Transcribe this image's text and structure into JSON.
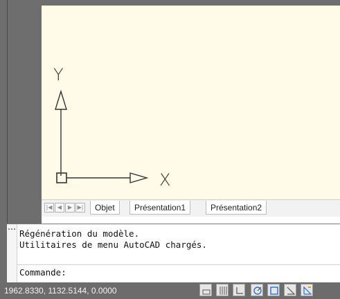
{
  "canvas": {
    "background": "#fffbe8",
    "ucs": {
      "x_label": "X",
      "y_label": "Y"
    }
  },
  "tabs": [
    {
      "label": "Objet",
      "active": true
    },
    {
      "label": "Présentation1",
      "active": false
    },
    {
      "label": "Présentation2",
      "active": false
    }
  ],
  "nav_buttons": [
    {
      "icon": "first-icon",
      "glyph": "|◀"
    },
    {
      "icon": "prev-icon",
      "glyph": "◀"
    },
    {
      "icon": "next-icon",
      "glyph": "▶"
    },
    {
      "icon": "last-icon",
      "glyph": "▶|"
    }
  ],
  "command_line": {
    "history": [
      "Régénération du modèle.",
      "Utilitaires de menu AutoCAD chargés."
    ],
    "prompt": "Commande:"
  },
  "status_bar": {
    "coordinates": "1962.8330, 1132.5144, 0.0000",
    "toggles": [
      {
        "icon": "snap-icon"
      },
      {
        "icon": "grid-icon"
      },
      {
        "icon": "ortho-icon"
      },
      {
        "icon": "polar-icon"
      },
      {
        "icon": "osnap-icon"
      },
      {
        "icon": "otrack-icon"
      },
      {
        "icon": "ducs-icon"
      }
    ]
  },
  "colors": {
    "frame": "#6e6e6e",
    "status_bar": "#6c6c6c",
    "accent_icon": "#2a6fd6"
  }
}
